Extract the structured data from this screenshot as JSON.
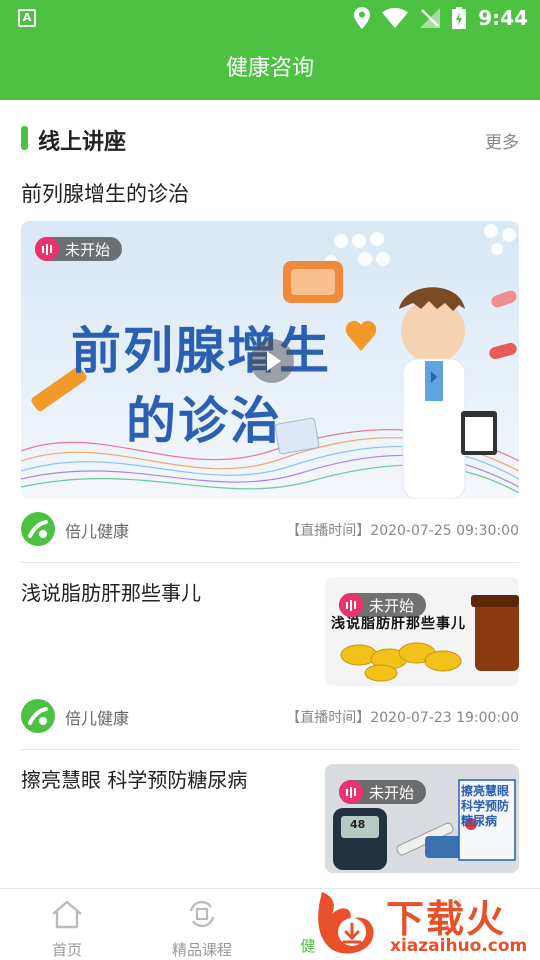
{
  "status": {
    "left_icon": "A",
    "time": "9:44"
  },
  "app": {
    "title": "健康咨询"
  },
  "section": {
    "title": "线上讲座",
    "more": "更多"
  },
  "featured": {
    "title": "前列腺增生的诊治",
    "cover_text_line1": "前列腺增生",
    "cover_text_line2": "的诊治",
    "badge": "未开始",
    "org": "倍儿健康",
    "time": "【直播时间】2020-07-25 09:30:00"
  },
  "lectures": [
    {
      "title": "浅说脂肪肝那些事儿",
      "badge": "未开始",
      "thumb_text": "浅说脂肪肝那些事儿",
      "org": "倍儿健康",
      "time": "【直播时间】2020-07-23 19:00:00"
    },
    {
      "title": "擦亮慧眼 科学预防糖尿病",
      "badge": "未开始",
      "thumb_text": "擦亮慧眼科学预防糖尿病",
      "thumb_reading": "48"
    }
  ],
  "nav": {
    "home": "首页",
    "courses": "精品课程",
    "health": "健"
  },
  "watermark": {
    "brand": "下载火",
    "url": "xiazaihuo.com"
  },
  "colors": {
    "primary": "#4cc142",
    "badge": "#e8336c",
    "watermark": "#e8502a"
  }
}
